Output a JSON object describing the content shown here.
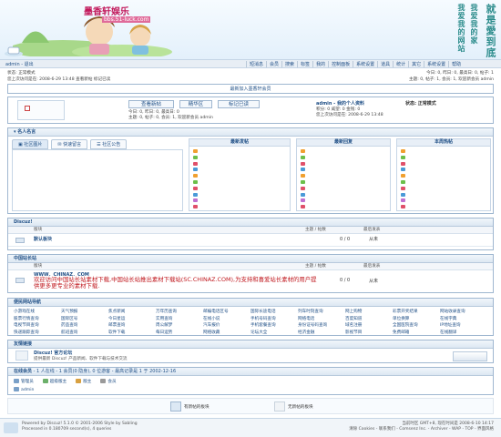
{
  "header": {
    "logo_text": "墨香轩娱乐",
    "logo_sub": "bbs.51-luck.com",
    "promo_lines": [
      "我爱我的网站",
      "我爱我的家",
      "就是愛到底"
    ]
  },
  "topbar": {
    "user_nav": "admin - 退出",
    "nav_items": [
      "短消息",
      "会员",
      "搜索",
      "标签",
      "我的",
      "控制面板",
      "系统设置",
      "道具",
      "统计",
      "其它",
      "系统设置",
      "帮助"
    ]
  },
  "status": {
    "left_line1": "状态: 正常模式",
    "left_line2": "您上次访问是在: 2008-6-29 13:48 查看新帖 标记已读",
    "right_line1": "今日: 0, 昨日: 0, 最高日: 0, 帖子: 1",
    "right_line2": "主题: 0, 帖子: 1, 会员: 1, 欢迎新会员 admin"
  },
  "notice": "最新加入墨香轩会员",
  "profile": {
    "buttons": [
      "查看新帖",
      "精华区",
      "标记已读"
    ],
    "stats_line1": "今日: 0, 昨日: 0, 最高日: 0",
    "stats_line2": "主题: 0, 帖子: 0, 会员: 1, 欢迎新会员 admin",
    "user_title": "admin - 我的个人资料",
    "user_state": "状态: 正常模式",
    "user_line1": "积分: 0  威望: 0  金钱: 0",
    "user_line2": "您上次访问是在: 2008-6-29 13:48"
  },
  "personal": {
    "title": "名人名言",
    "tabs": [
      "社区图片",
      "快速留言",
      "社区公告"
    ],
    "columns": [
      "最新发帖",
      "最新回复",
      "本周热帖"
    ]
  },
  "discuz_section": {
    "title": "Discuz!",
    "header_cols": [
      "版块",
      "主题 / 帖数",
      "最后发表"
    ],
    "forum_name": "默认板块",
    "forum_count": "0 / 0",
    "forum_last": "从未"
  },
  "china_section": {
    "title": "中国站长站",
    "header_cols": [
      "版块",
      "主题 / 帖数",
      "最后发表"
    ],
    "forum_name": "WWW．CHINAZ．COM",
    "forum_desc": "欢迎访问中国站长站素材下载,中国站长站推出素材下载站(SC.CHINAZ.COM),为支持和喜爱站长素材的用户提供更多更专业的素材下载.",
    "forum_count": "0 / 0",
    "forum_last": "从未"
  },
  "friend_links": {
    "title": "便民网站导航",
    "links": [
      "小游戏在线",
      "天气预报",
      "焦点新闻",
      "万年历查询",
      "邮编电话区号",
      "国际长途电话",
      "列车时刻查询",
      "网上购物",
      "彩票开奖结果",
      "网站收录查询",
      "股票行情查询",
      "国际区号",
      "今日星运",
      "实用查询",
      "在线小说",
      "手机号码查询",
      "网络电话",
      "百度知道",
      "单位换算",
      "在线字典",
      "电视节目查询",
      "药品查询",
      "邮票查询",
      "周公解梦",
      "汽车报价",
      "手机套餐查询",
      "身份证号码查询",
      "域名注册",
      "全国医院查询",
      "IP地址查询",
      "快递跟踪查询",
      "航班查询",
      "软件下载",
      "每日运势",
      "网络收藏",
      "论坛大全",
      "经济金融",
      "影视节目",
      "免费邮箱",
      "在线翻译"
    ]
  },
  "friends": {
    "title": "友情链接",
    "name": "Discuz! 官方论坛",
    "desc": "提供最新 Discuz! 产品新闻、软件下载与技术交流"
  },
  "online": {
    "title": "在线会员",
    "summary": "- 1 人在线 - 1 会员(0 隐身), 0 位游客 - 最高记录是 1 于 2002-12-16",
    "legends": [
      "管理员",
      "超级版主",
      "版主",
      "会员"
    ],
    "member": "admin"
  },
  "legend": {
    "new_posts": "有新帖的板块",
    "no_new": "无新帖的板块"
  },
  "footer": {
    "powered": "Powered by Discuz! 5.1.0 © 2001-2006 Style by Sabling",
    "processed": "Processed in 0.180709 second(s), 4 queries",
    "timezone": "当前时区 GMT+8, 现在时间是 2008-6-10 14:17",
    "links": "清除 Cookies - 联系我们 - Comsenz Inc. - Archiver - WAP - TOP - 界面风格"
  }
}
